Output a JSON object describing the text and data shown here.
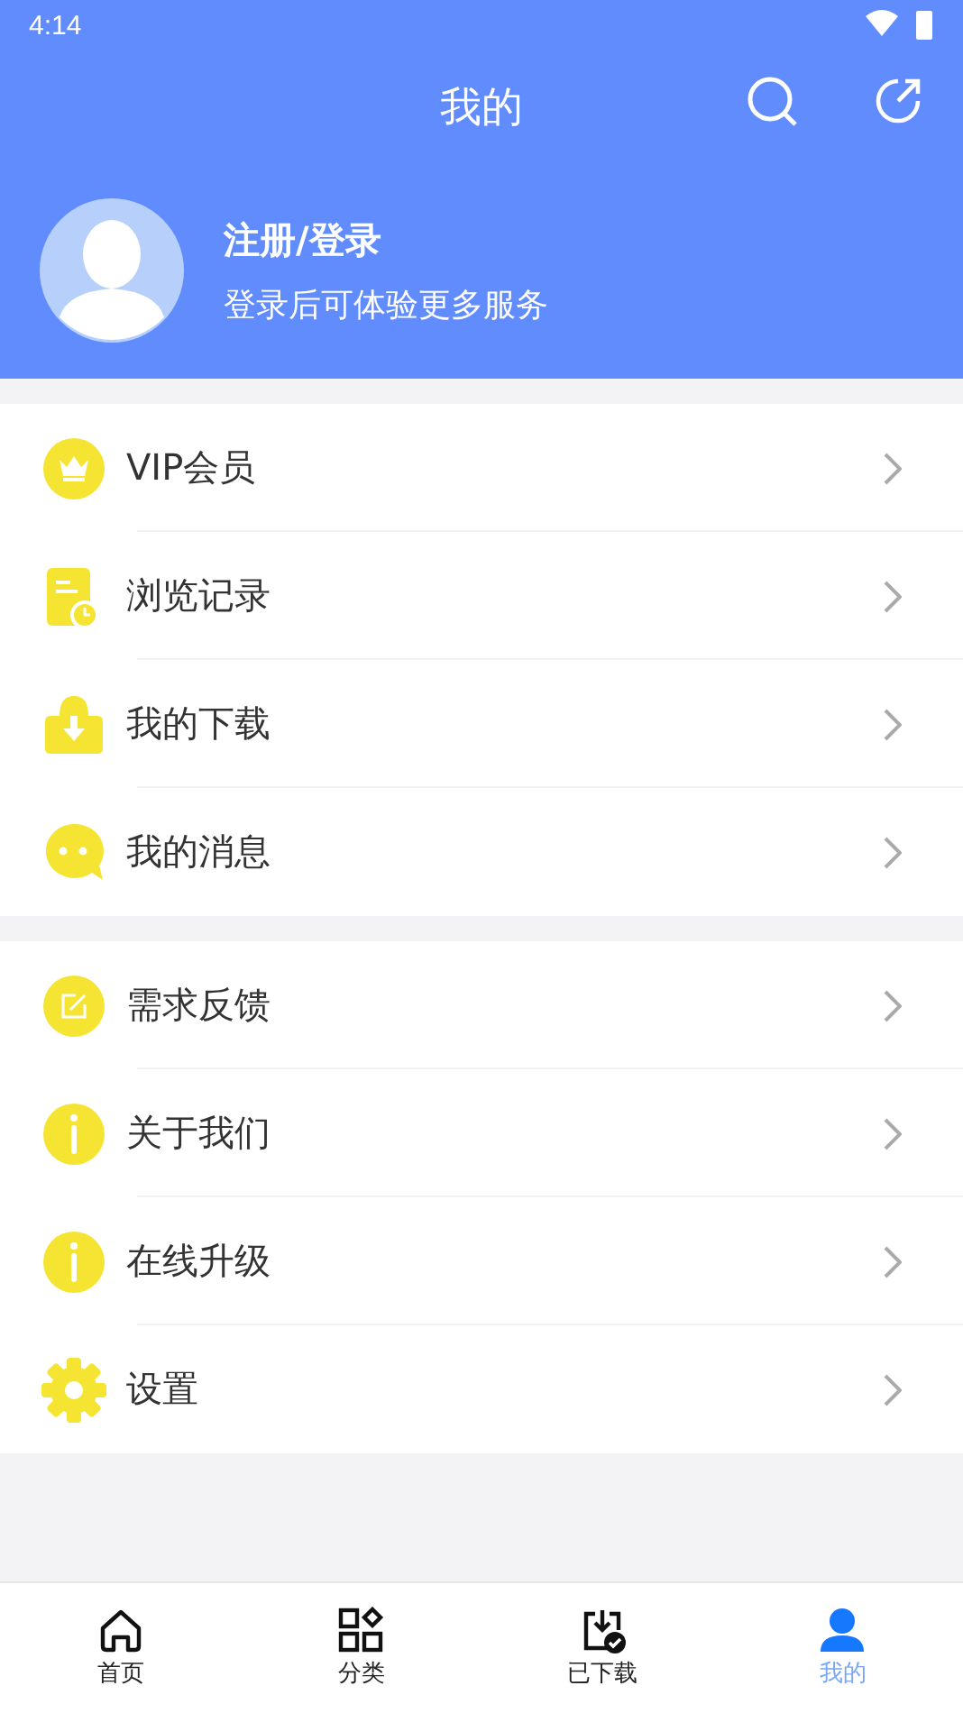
{
  "status_bar": {
    "time": "4:14"
  },
  "header": {
    "title": "我的"
  },
  "profile": {
    "name": "注册/登录",
    "subtitle": "登录后可体验更多服务"
  },
  "menu_groups": [
    {
      "items": [
        {
          "label": "VIP会员",
          "kind": "crown"
        },
        {
          "label": "浏览记录",
          "kind": "history"
        },
        {
          "label": "我的下载",
          "kind": "download"
        },
        {
          "label": "我的消息",
          "kind": "chat"
        }
      ]
    },
    {
      "items": [
        {
          "label": "需求反馈",
          "kind": "edit"
        },
        {
          "label": "关于我们",
          "kind": "info"
        },
        {
          "label": "在线升级",
          "kind": "info"
        },
        {
          "label": "设置",
          "kind": "gear"
        }
      ]
    }
  ],
  "bottom_nav": [
    {
      "label": "首页",
      "kind": "home",
      "selected": false
    },
    {
      "label": "分类",
      "kind": "grid",
      "selected": false
    },
    {
      "label": "已下载",
      "kind": "downloaded",
      "selected": false
    },
    {
      "label": "我的",
      "kind": "person",
      "selected": true
    }
  ]
}
